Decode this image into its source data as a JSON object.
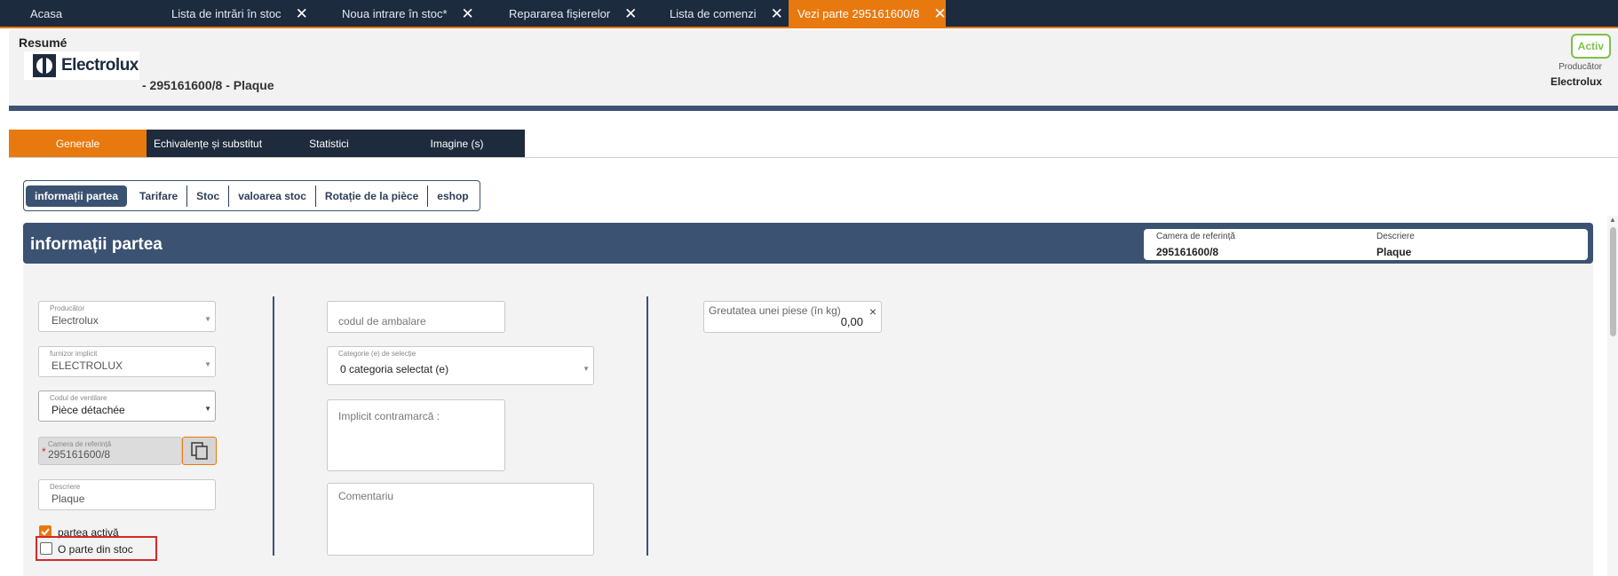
{
  "top_tabs": {
    "home": "Acasa",
    "stock_entries": "Lista de intrări în stoc",
    "new_entry": "Noua intrare în stoc*",
    "file_repair": "Repararea fișierelor",
    "orders": "Lista de comenzi",
    "view_part": "Vezi parte 295161600/8",
    "close_glyph": "✕"
  },
  "summary": {
    "title": "Resumé",
    "logo_text": "Electrolux",
    "part_title": "- 295161600/8 - Plaque",
    "status_badge": "Activ",
    "producer_label": "Producător",
    "producer_value": "Electrolux"
  },
  "main_tabs": [
    "Generale",
    "Echivalențe și substitut",
    "Statistici",
    "Imagine (s)"
  ],
  "sub_tabs": [
    "informații partea",
    "Tarifare",
    "Stoc",
    "valoarea stoc",
    "Rotație de la pièce",
    "eshop"
  ],
  "panel": {
    "title": "informații partea",
    "ref_label": "Camera de referință",
    "ref_value": "295161600/8",
    "desc_label": "Descriere",
    "desc_value": "Plaque"
  },
  "form": {
    "producer_label": "Producător",
    "producer_value": "Electrolux",
    "supplier_label": "furnizor implicit",
    "supplier_value": "ELECTROLUX",
    "vent_label": "Codul de ventilare",
    "vent_value": "Pièce détachée",
    "ref_label": "Camera de referință",
    "ref_value": "295161600/8",
    "required_mark": "*",
    "desc_label": "Descriere",
    "desc_value": "Plaque",
    "active_part_label": "partea activă",
    "active_part_checked": true,
    "stock_part_label": "O parte din stoc",
    "stock_part_checked": false,
    "packaging_placeholder": "codul de ambalare",
    "category_label": "Categorie (e) de selecție",
    "category_value": "0 categoria selectat (e)",
    "countermark_placeholder": "Implicit contramarcă :",
    "comment_placeholder": "Comentariu",
    "weight_label": "Greutatea unei piese (în kg)",
    "weight_value": "0,00",
    "weight_clear": "×"
  },
  "colors": {
    "accent": "#e8790f",
    "navy": "#1c2b3e",
    "panel_header": "#3b5272",
    "active_badge": "#7cc24a",
    "highlight": "#d62828"
  },
  "icons": [
    "electrolux-logo",
    "close-icon",
    "chevron-down-icon",
    "copy-icon",
    "checkbox-checked-icon",
    "checkbox-icon"
  ]
}
